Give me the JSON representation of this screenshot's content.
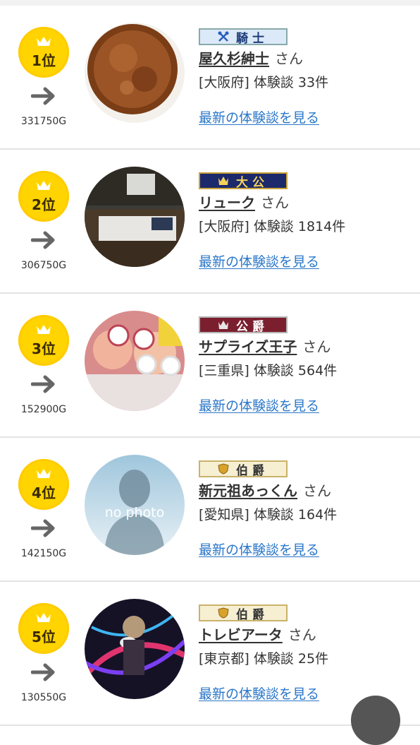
{
  "rankings": [
    {
      "rank_label": "1位",
      "points": "331750G",
      "title_badge": "騎士",
      "title_icon": "crossed-axes-icon",
      "name": "屋久杉紳士",
      "honorific": "さん",
      "prefecture": "[大阪府]",
      "reviews": "体験談 33件",
      "latest_link": "最新の体験談を見る",
      "avatar": "wood-plate-photo",
      "badge_colors": {
        "bg": "#dbe9f8",
        "text": "#1f3e7a",
        "border": "#8aa"
      }
    },
    {
      "rank_label": "2位",
      "points": "306750G",
      "title_badge": "大公",
      "title_icon": "crown-icon",
      "name": "リューク",
      "honorific": "さん",
      "prefecture": "[大阪府]",
      "reviews": "体験談 1814件",
      "latest_link": "最新の体験談を見る",
      "avatar": "bedroom-photo",
      "badge_colors": {
        "bg": "#1c2a6b",
        "text": "#f4d25a",
        "border": "#c9a43a"
      }
    },
    {
      "rank_label": "3位",
      "points": "152900G",
      "title_badge": "公爵",
      "title_icon": "crown-icon",
      "name": "サプライズ王子",
      "honorific": "さん",
      "prefecture": "[三重県]",
      "reviews": "体験談 564件",
      "latest_link": "最新の体験談を見る",
      "avatar": "selfie-photo",
      "badge_colors": {
        "bg": "#7b1f2e",
        "text": "#ffffff",
        "border": "#b5b5b5"
      }
    },
    {
      "rank_label": "4位",
      "points": "142150G",
      "title_badge": "伯爵",
      "title_icon": "shield-icon",
      "name": "新元祖あっくん",
      "honorific": "さん",
      "prefecture": "[愛知県]",
      "reviews": "体験談 164件",
      "latest_link": "最新の体験談を見る",
      "avatar": "no-photo",
      "avatar_text": "no photo",
      "badge_colors": {
        "bg": "#f6efd2",
        "text": "#333333",
        "border": "#c9b26a"
      }
    },
    {
      "rank_label": "5位",
      "points": "130550G",
      "title_badge": "伯爵",
      "title_icon": "shield-icon",
      "name": "トレビアータ",
      "honorific": "さん",
      "prefecture": "[東京都]",
      "reviews": "体験談 25件",
      "latest_link": "最新の体験談を見る",
      "avatar": "neon-photo",
      "badge_colors": {
        "bg": "#f6efd2",
        "text": "#333333",
        "border": "#c9b26a"
      }
    }
  ],
  "colors": {
    "medal": "#ffd400",
    "link": "#2a77c9",
    "divider": "#e3e3e3"
  }
}
